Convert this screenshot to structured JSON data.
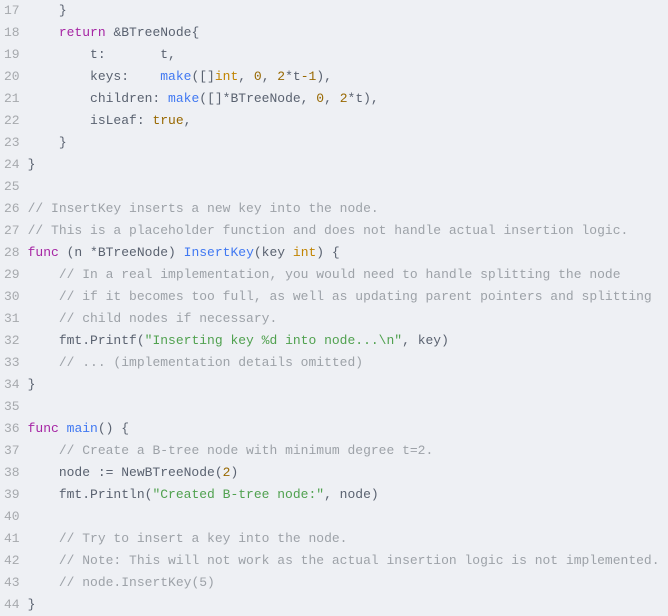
{
  "code": {
    "language": "go",
    "first_line": 17,
    "lines": [
      {
        "n": 17,
        "seg": [
          {
            "c": "tok-op",
            "t": "    }"
          }
        ]
      },
      {
        "n": 18,
        "seg": [
          {
            "c": "tok-op",
            "t": "    "
          },
          {
            "c": "tok-kw",
            "t": "return"
          },
          {
            "c": "tok-op",
            "t": " &BTreeNode{"
          }
        ]
      },
      {
        "n": 19,
        "seg": [
          {
            "c": "tok-op",
            "t": "        t:       t,"
          }
        ]
      },
      {
        "n": 20,
        "seg": [
          {
            "c": "tok-op",
            "t": "        keys:    "
          },
          {
            "c": "tok-fn",
            "t": "make"
          },
          {
            "c": "tok-op",
            "t": "([]"
          },
          {
            "c": "tok-type",
            "t": "int"
          },
          {
            "c": "tok-op",
            "t": ", "
          },
          {
            "c": "tok-num",
            "t": "0"
          },
          {
            "c": "tok-op",
            "t": ", "
          },
          {
            "c": "tok-num",
            "t": "2"
          },
          {
            "c": "tok-op",
            "t": "*t"
          },
          {
            "c": "tok-num",
            "t": "-1"
          },
          {
            "c": "tok-op",
            "t": "),"
          }
        ]
      },
      {
        "n": 21,
        "seg": [
          {
            "c": "tok-op",
            "t": "        children: "
          },
          {
            "c": "tok-fn",
            "t": "make"
          },
          {
            "c": "tok-op",
            "t": "([]*BTreeNode, "
          },
          {
            "c": "tok-num",
            "t": "0"
          },
          {
            "c": "tok-op",
            "t": ", "
          },
          {
            "c": "tok-num",
            "t": "2"
          },
          {
            "c": "tok-op",
            "t": "*t),"
          }
        ]
      },
      {
        "n": 22,
        "seg": [
          {
            "c": "tok-op",
            "t": "        isLeaf: "
          },
          {
            "c": "tok-bool",
            "t": "true"
          },
          {
            "c": "tok-op",
            "t": ","
          }
        ]
      },
      {
        "n": 23,
        "seg": [
          {
            "c": "tok-op",
            "t": "    }"
          }
        ]
      },
      {
        "n": 24,
        "seg": [
          {
            "c": "tok-op",
            "t": "}"
          }
        ]
      },
      {
        "n": 25,
        "seg": [
          {
            "c": "tok-op",
            "t": ""
          }
        ]
      },
      {
        "n": 26,
        "seg": [
          {
            "c": "tok-cmt",
            "t": "// InsertKey inserts a new key into the node."
          }
        ]
      },
      {
        "n": 27,
        "seg": [
          {
            "c": "tok-cmt",
            "t": "// This is a placeholder function and does not handle actual insertion logic."
          }
        ]
      },
      {
        "n": 28,
        "seg": [
          {
            "c": "tok-kw",
            "t": "func"
          },
          {
            "c": "tok-op",
            "t": " (n *BTreeNode) "
          },
          {
            "c": "tok-fn",
            "t": "InsertKey"
          },
          {
            "c": "tok-op",
            "t": "(key "
          },
          {
            "c": "tok-type",
            "t": "int"
          },
          {
            "c": "tok-op",
            "t": ") {"
          }
        ]
      },
      {
        "n": 29,
        "seg": [
          {
            "c": "tok-op",
            "t": "    "
          },
          {
            "c": "tok-cmt",
            "t": "// In a real implementation, you would need to handle splitting the node"
          }
        ]
      },
      {
        "n": 30,
        "seg": [
          {
            "c": "tok-op",
            "t": "    "
          },
          {
            "c": "tok-cmt",
            "t": "// if it becomes too full, as well as updating parent pointers and splitting"
          }
        ]
      },
      {
        "n": 31,
        "seg": [
          {
            "c": "tok-op",
            "t": "    "
          },
          {
            "c": "tok-cmt",
            "t": "// child nodes if necessary."
          }
        ]
      },
      {
        "n": 32,
        "seg": [
          {
            "c": "tok-op",
            "t": "    fmt.Printf("
          },
          {
            "c": "tok-str",
            "t": "\"Inserting key %d into node...\\n\""
          },
          {
            "c": "tok-op",
            "t": ", key)"
          }
        ]
      },
      {
        "n": 33,
        "seg": [
          {
            "c": "tok-op",
            "t": "    "
          },
          {
            "c": "tok-cmt",
            "t": "// ... (implementation details omitted)"
          }
        ]
      },
      {
        "n": 34,
        "seg": [
          {
            "c": "tok-op",
            "t": "}"
          }
        ]
      },
      {
        "n": 35,
        "seg": [
          {
            "c": "tok-op",
            "t": ""
          }
        ]
      },
      {
        "n": 36,
        "seg": [
          {
            "c": "tok-kw",
            "t": "func"
          },
          {
            "c": "tok-op",
            "t": " "
          },
          {
            "c": "tok-fn",
            "t": "main"
          },
          {
            "c": "tok-op",
            "t": "() {"
          }
        ]
      },
      {
        "n": 37,
        "seg": [
          {
            "c": "tok-op",
            "t": "    "
          },
          {
            "c": "tok-cmt",
            "t": "// Create a B-tree node with minimum degree t=2."
          }
        ]
      },
      {
        "n": 38,
        "seg": [
          {
            "c": "tok-op",
            "t": "    node := NewBTreeNode("
          },
          {
            "c": "tok-num",
            "t": "2"
          },
          {
            "c": "tok-op",
            "t": ")"
          }
        ]
      },
      {
        "n": 39,
        "seg": [
          {
            "c": "tok-op",
            "t": "    fmt.Println("
          },
          {
            "c": "tok-str",
            "t": "\"Created B-tree node:\""
          },
          {
            "c": "tok-op",
            "t": ", node)"
          }
        ]
      },
      {
        "n": 40,
        "seg": [
          {
            "c": "tok-op",
            "t": ""
          }
        ]
      },
      {
        "n": 41,
        "seg": [
          {
            "c": "tok-op",
            "t": "    "
          },
          {
            "c": "tok-cmt",
            "t": "// Try to insert a key into the node."
          }
        ]
      },
      {
        "n": 42,
        "seg": [
          {
            "c": "tok-op",
            "t": "    "
          },
          {
            "c": "tok-cmt",
            "t": "// Note: This will not work as the actual insertion logic is not implemented."
          }
        ]
      },
      {
        "n": 43,
        "seg": [
          {
            "c": "tok-op",
            "t": "    "
          },
          {
            "c": "tok-cmt",
            "t": "// node.InsertKey(5)"
          }
        ]
      },
      {
        "n": 44,
        "seg": [
          {
            "c": "tok-op",
            "t": "}"
          }
        ]
      }
    ]
  }
}
